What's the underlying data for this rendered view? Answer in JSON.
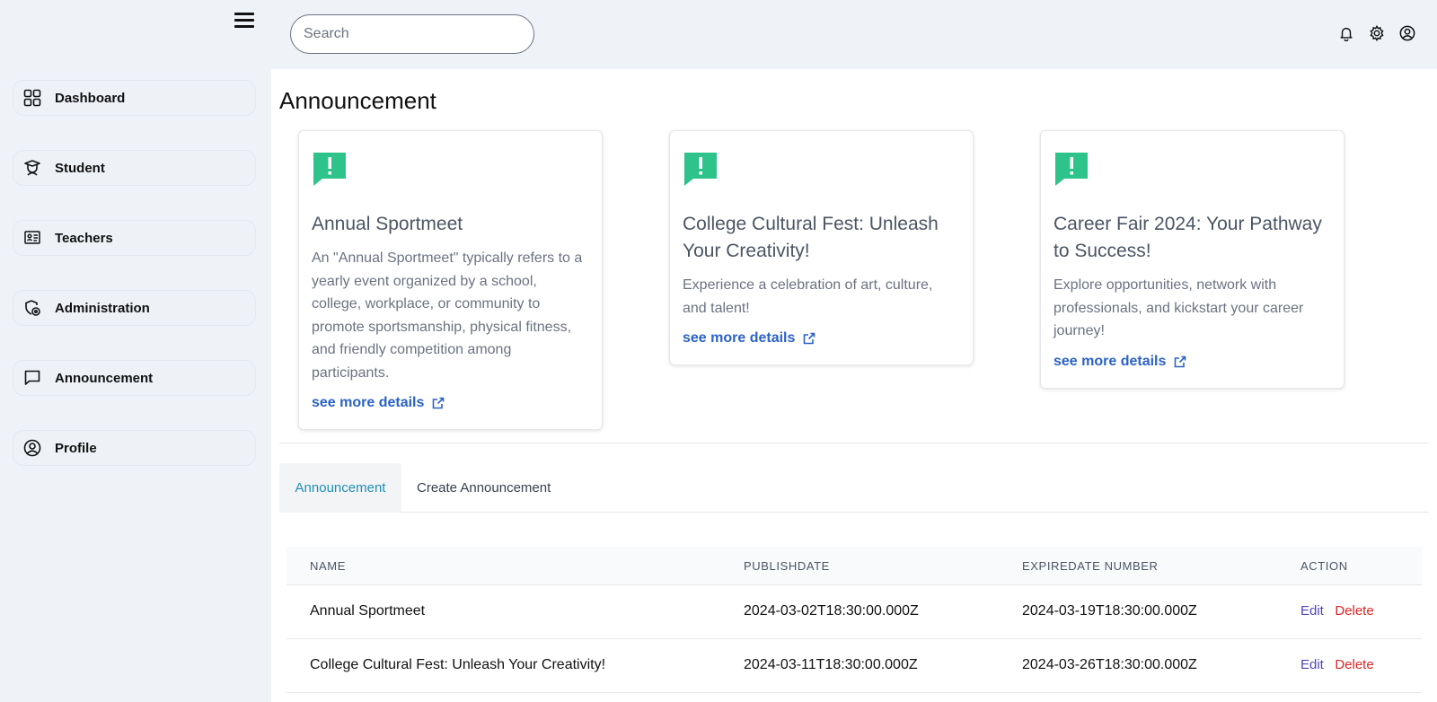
{
  "sidebar": {
    "items": [
      {
        "label": "Dashboard",
        "icon": "grid-icon"
      },
      {
        "label": "Student",
        "icon": "graduate-icon"
      },
      {
        "label": "Teachers",
        "icon": "id-card-icon"
      },
      {
        "label": "Administration",
        "icon": "admin-icon"
      },
      {
        "label": "Announcement",
        "icon": "message-icon"
      },
      {
        "label": "Profile",
        "icon": "user-circle-icon"
      }
    ]
  },
  "header": {
    "search_placeholder": "Search",
    "icons": [
      "bell-icon",
      "gear-icon",
      "user-circle-icon"
    ]
  },
  "main": {
    "title": "Announcement",
    "accent_color": "#2ec38a",
    "link_color": "#2b62c6",
    "cards": [
      {
        "title": "Annual Sportmeet",
        "description": "An \"Annual Sportmeet\" typically refers to a yearly event organized by a school, college, workplace, or community to promote sportsmanship, physical fitness, and friendly competition among participants.",
        "link": "see more details"
      },
      {
        "title": "College Cultural Fest: Unleash Your Creativity!",
        "description": "Experience a celebration of art, culture, and talent!",
        "link": "see more details"
      },
      {
        "title": "Career Fair 2024: Your Pathway to Success!",
        "description": "Explore opportunities, network with professionals, and kickstart your career journey!",
        "link": "see more details"
      }
    ],
    "tabs": [
      {
        "label": "Announcement",
        "active": true
      },
      {
        "label": "Create Announcement",
        "active": false
      }
    ],
    "table": {
      "headers": [
        "NAME",
        "PUBLISHDATE",
        "EXPIREDATE NUMBER",
        "ACTION"
      ],
      "rows": [
        {
          "name": "Annual Sportmeet",
          "publish": "2024-03-02T18:30:00.000Z",
          "expire": "2024-03-19T18:30:00.000Z",
          "edit": "Edit",
          "delete": "Delete"
        },
        {
          "name": "College Cultural Fest: Unleash Your Creativity!",
          "publish": "2024-03-11T18:30:00.000Z",
          "expire": "2024-03-26T18:30:00.000Z",
          "edit": "Edit",
          "delete": "Delete"
        }
      ]
    }
  }
}
